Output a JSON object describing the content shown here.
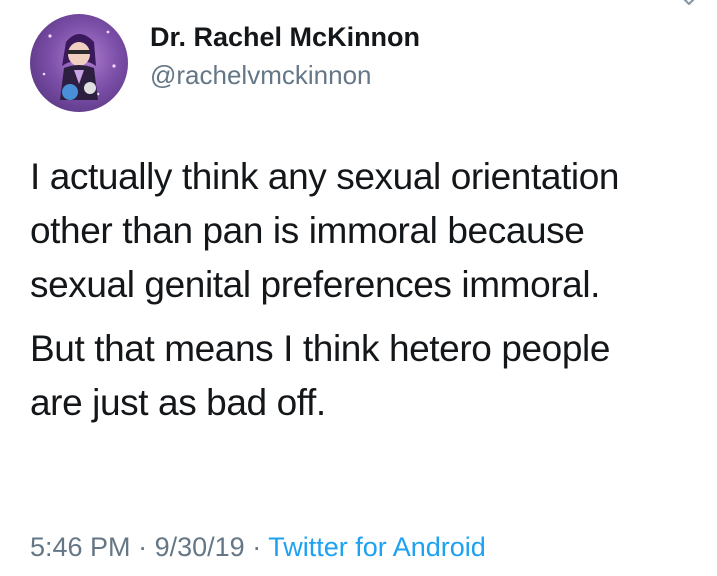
{
  "author": {
    "name": "Dr. Rachel McKinnon",
    "handle": "@rachelvmckinnon"
  },
  "tweet": {
    "paragraphs": [
      [
        "I actually think any sexual orientation",
        "other than pan is immoral because",
        "sexual genital preferences immoral."
      ],
      [
        "But that means I think hetero people",
        "are just as bad off."
      ]
    ]
  },
  "meta": {
    "time": "5:46 PM",
    "date": "9/30/19",
    "separator": "·",
    "source": "Twitter for Android"
  },
  "colors": {
    "text": "#14171a",
    "secondary": "#657786",
    "link": "#1da1f2"
  },
  "icons": {
    "menu": "chevron-down-icon",
    "avatar": "profile-avatar"
  }
}
